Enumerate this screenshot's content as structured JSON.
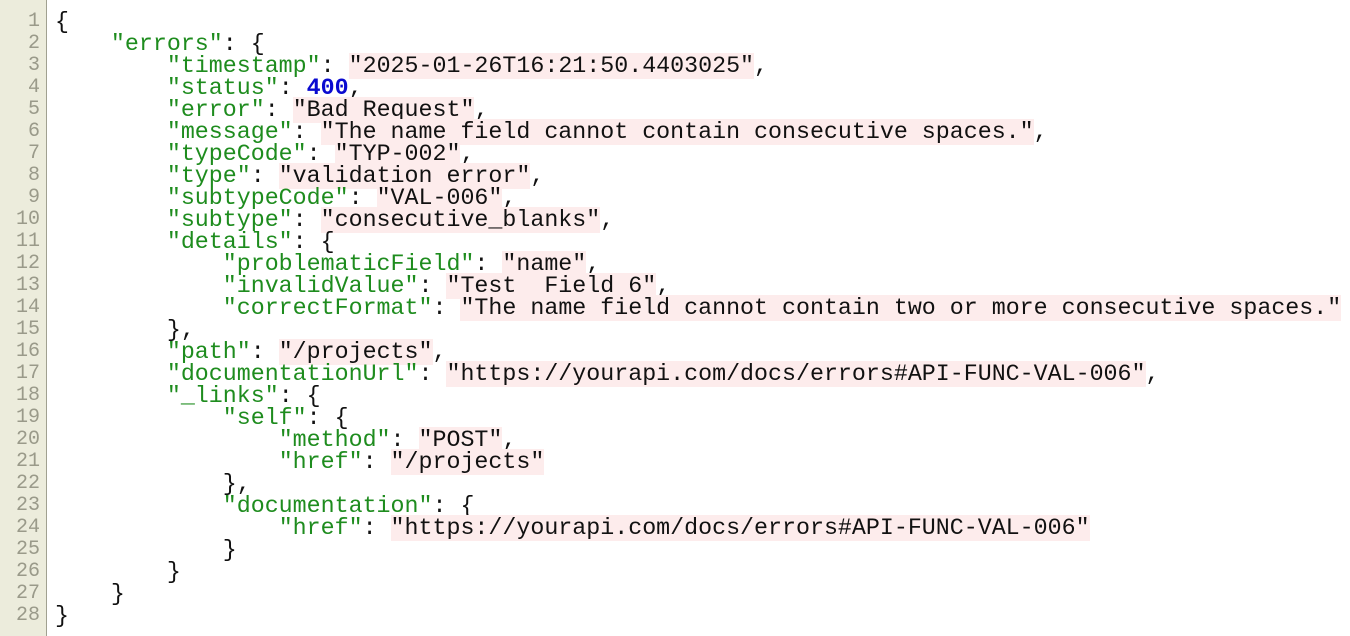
{
  "editor": {
    "colors": {
      "key": "#1e8c1e",
      "number": "#0a0ad0",
      "string_bg": "#fdecec",
      "gutter_bg": "#ececdc"
    },
    "lines": [
      {
        "n": "1",
        "tokens": [
          {
            "t": "punct",
            "v": "{"
          }
        ]
      },
      {
        "n": "2",
        "tokens": [
          {
            "t": "ws",
            "v": "    "
          },
          {
            "t": "key",
            "v": "\"errors\""
          },
          {
            "t": "punct",
            "v": ": {"
          }
        ]
      },
      {
        "n": "3",
        "tokens": [
          {
            "t": "ws",
            "v": "        "
          },
          {
            "t": "key",
            "v": "\"timestamp\""
          },
          {
            "t": "punct",
            "v": ": "
          },
          {
            "t": "str",
            "v": "\"2025-01-26T16:21:50.4403025\""
          },
          {
            "t": "punct",
            "v": ","
          }
        ]
      },
      {
        "n": "4",
        "tokens": [
          {
            "t": "ws",
            "v": "        "
          },
          {
            "t": "key",
            "v": "\"status\""
          },
          {
            "t": "punct",
            "v": ": "
          },
          {
            "t": "num",
            "v": "400"
          },
          {
            "t": "punct",
            "v": ","
          }
        ]
      },
      {
        "n": "5",
        "tokens": [
          {
            "t": "ws",
            "v": "        "
          },
          {
            "t": "key",
            "v": "\"error\""
          },
          {
            "t": "punct",
            "v": ": "
          },
          {
            "t": "str",
            "v": "\"Bad Request\""
          },
          {
            "t": "punct",
            "v": ","
          }
        ]
      },
      {
        "n": "6",
        "tokens": [
          {
            "t": "ws",
            "v": "        "
          },
          {
            "t": "key",
            "v": "\"message\""
          },
          {
            "t": "punct",
            "v": ": "
          },
          {
            "t": "str",
            "v": "\"The name field cannot contain consecutive spaces.\""
          },
          {
            "t": "punct",
            "v": ","
          }
        ]
      },
      {
        "n": "7",
        "tokens": [
          {
            "t": "ws",
            "v": "        "
          },
          {
            "t": "key",
            "v": "\"typeCode\""
          },
          {
            "t": "punct",
            "v": ": "
          },
          {
            "t": "str",
            "v": "\"TYP-002\""
          },
          {
            "t": "punct",
            "v": ","
          }
        ]
      },
      {
        "n": "8",
        "tokens": [
          {
            "t": "ws",
            "v": "        "
          },
          {
            "t": "key",
            "v": "\"type\""
          },
          {
            "t": "punct",
            "v": ": "
          },
          {
            "t": "str",
            "v": "\"validation error\""
          },
          {
            "t": "punct",
            "v": ","
          }
        ]
      },
      {
        "n": "9",
        "tokens": [
          {
            "t": "ws",
            "v": "        "
          },
          {
            "t": "key",
            "v": "\"subtypeCode\""
          },
          {
            "t": "punct",
            "v": ": "
          },
          {
            "t": "str",
            "v": "\"VAL-006\""
          },
          {
            "t": "punct",
            "v": ","
          }
        ]
      },
      {
        "n": "10",
        "tokens": [
          {
            "t": "ws",
            "v": "        "
          },
          {
            "t": "key",
            "v": "\"subtype\""
          },
          {
            "t": "punct",
            "v": ": "
          },
          {
            "t": "str",
            "v": "\"consecutive_blanks\""
          },
          {
            "t": "punct",
            "v": ","
          }
        ]
      },
      {
        "n": "11",
        "tokens": [
          {
            "t": "ws",
            "v": "        "
          },
          {
            "t": "key",
            "v": "\"details\""
          },
          {
            "t": "punct",
            "v": ": {"
          }
        ]
      },
      {
        "n": "12",
        "tokens": [
          {
            "t": "ws",
            "v": "            "
          },
          {
            "t": "key",
            "v": "\"problematicField\""
          },
          {
            "t": "punct",
            "v": ": "
          },
          {
            "t": "str",
            "v": "\"name\""
          },
          {
            "t": "punct",
            "v": ","
          }
        ]
      },
      {
        "n": "13",
        "tokens": [
          {
            "t": "ws",
            "v": "            "
          },
          {
            "t": "key",
            "v": "\"invalidValue\""
          },
          {
            "t": "punct",
            "v": ": "
          },
          {
            "t": "str",
            "v": "\"Test  Field 6\""
          },
          {
            "t": "punct",
            "v": ","
          }
        ]
      },
      {
        "n": "14",
        "tokens": [
          {
            "t": "ws",
            "v": "            "
          },
          {
            "t": "key",
            "v": "\"correctFormat\""
          },
          {
            "t": "punct",
            "v": ": "
          },
          {
            "t": "str",
            "v": "\"The name field cannot contain two or more consecutive spaces.\""
          }
        ]
      },
      {
        "n": "15",
        "tokens": [
          {
            "t": "ws",
            "v": "        "
          },
          {
            "t": "punct",
            "v": "},"
          }
        ]
      },
      {
        "n": "16",
        "tokens": [
          {
            "t": "ws",
            "v": "        "
          },
          {
            "t": "key",
            "v": "\"path\""
          },
          {
            "t": "punct",
            "v": ": "
          },
          {
            "t": "str",
            "v": "\"/projects\""
          },
          {
            "t": "punct",
            "v": ","
          }
        ]
      },
      {
        "n": "17",
        "tokens": [
          {
            "t": "ws",
            "v": "        "
          },
          {
            "t": "key",
            "v": "\"documentationUrl\""
          },
          {
            "t": "punct",
            "v": ": "
          },
          {
            "t": "str",
            "v": "\"https://yourapi.com/docs/errors#API-FUNC-VAL-006\""
          },
          {
            "t": "punct",
            "v": ","
          }
        ]
      },
      {
        "n": "18",
        "tokens": [
          {
            "t": "ws",
            "v": "        "
          },
          {
            "t": "key",
            "v": "\"_links\""
          },
          {
            "t": "punct",
            "v": ": {"
          }
        ]
      },
      {
        "n": "19",
        "tokens": [
          {
            "t": "ws",
            "v": "            "
          },
          {
            "t": "key",
            "v": "\"self\""
          },
          {
            "t": "punct",
            "v": ": {"
          }
        ]
      },
      {
        "n": "20",
        "tokens": [
          {
            "t": "ws",
            "v": "                "
          },
          {
            "t": "key",
            "v": "\"method\""
          },
          {
            "t": "punct",
            "v": ": "
          },
          {
            "t": "str",
            "v": "\"POST\""
          },
          {
            "t": "punct",
            "v": ","
          }
        ]
      },
      {
        "n": "21",
        "tokens": [
          {
            "t": "ws",
            "v": "                "
          },
          {
            "t": "key",
            "v": "\"href\""
          },
          {
            "t": "punct",
            "v": ": "
          },
          {
            "t": "str",
            "v": "\"/projects\""
          }
        ]
      },
      {
        "n": "22",
        "tokens": [
          {
            "t": "ws",
            "v": "            "
          },
          {
            "t": "punct",
            "v": "},"
          }
        ]
      },
      {
        "n": "23",
        "tokens": [
          {
            "t": "ws",
            "v": "            "
          },
          {
            "t": "key",
            "v": "\"documentation\""
          },
          {
            "t": "punct",
            "v": ": {"
          }
        ]
      },
      {
        "n": "24",
        "tokens": [
          {
            "t": "ws",
            "v": "                "
          },
          {
            "t": "key",
            "v": "\"href\""
          },
          {
            "t": "punct",
            "v": ": "
          },
          {
            "t": "str",
            "v": "\"https://yourapi.com/docs/errors#API-FUNC-VAL-006\""
          }
        ]
      },
      {
        "n": "25",
        "tokens": [
          {
            "t": "ws",
            "v": "            "
          },
          {
            "t": "punct",
            "v": "}"
          }
        ]
      },
      {
        "n": "26",
        "tokens": [
          {
            "t": "ws",
            "v": "        "
          },
          {
            "t": "punct",
            "v": "}"
          }
        ]
      },
      {
        "n": "27",
        "tokens": [
          {
            "t": "ws",
            "v": "    "
          },
          {
            "t": "punct",
            "v": "}"
          }
        ]
      },
      {
        "n": "28",
        "tokens": [
          {
            "t": "punct",
            "v": "}"
          }
        ]
      }
    ]
  }
}
